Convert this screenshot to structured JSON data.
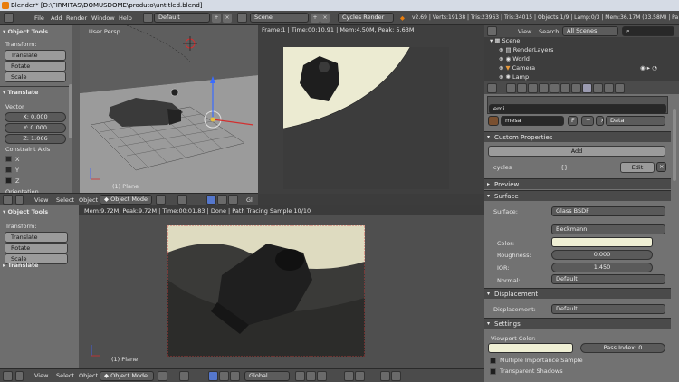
{
  "title": "Blender* [D:\\FIRMITAS\\DOMUSDOME\\produto\\untitled.blend]",
  "menu": {
    "items": [
      "File",
      "Add",
      "Render",
      "Window",
      "Help"
    ],
    "layout": "Default",
    "scene": "Scene",
    "engine": "Cycles Render",
    "stats": "v2.69 | Verts:19138 | Tris:23963 | Tris:34015 | Objects:1/9 | Lamp:0/3 | Mem:36.17M (33.58M) | Pa"
  },
  "tools": {
    "header": "Object Tools",
    "transform_label": "Transform:",
    "buttons": [
      "Translate",
      "Rotate",
      "Scale"
    ]
  },
  "translate_panel": {
    "header": "Translate",
    "vector_label": "Vector",
    "x": "X: 0.000",
    "y": "Y: 0.000",
    "z": "Z: 1.066",
    "constraint_label": "Constraint Axis",
    "axes": [
      "X",
      "Y",
      "Z"
    ],
    "orientation_label": "Orientation"
  },
  "tools2": {
    "header": "Object Tools",
    "transform_label": "Transform:",
    "buttons": [
      "Translate",
      "Rotate",
      "Scale"
    ],
    "translate": "Translate"
  },
  "viewport_top": {
    "label": "User Persp",
    "object": "(1) Plane"
  },
  "render_top": {
    "info": "Frame:1 | Time:00:10.91 | Mem:4.50M, Peak: 5.63M"
  },
  "header_mid": {
    "view": "View",
    "select": "Select",
    "object": "Object",
    "mode": "Object Mode",
    "gl": "Gl"
  },
  "render_bottom": {
    "info": "Mem:9.72M, Peak:9.72M | Time:00:01.83 | Done | Path Tracing Sample 10/10",
    "object": "(1) Plane"
  },
  "header_bottom": {
    "view": "View",
    "select": "Select",
    "object": "Object",
    "mode": "Object Mode",
    "orientation": "Global"
  },
  "outliner": {
    "view": "View",
    "search": "Search",
    "filter": "All Scenes",
    "items": [
      "Scene",
      "RenderLayers",
      "World",
      "Camera",
      "Lamp"
    ]
  },
  "properties": {
    "material_search": "emi",
    "material_name": "mesa",
    "f_label": "F",
    "data": "Data",
    "custom_props": "Custom Properties",
    "add": "Add",
    "cycles": "cycles",
    "cycles_val": "{}",
    "edit": "Edit",
    "preview": "Preview",
    "surface": "Surface",
    "surface_label": "Surface:",
    "surface_val": "Glass BSDF",
    "distribution": "Beckmann",
    "color_label": "Color:",
    "roughness_label": "Roughness:",
    "roughness": "0.000",
    "ior_label": "IOR:",
    "ior": "1.450",
    "normal_label": "Normal:",
    "normal": "Default",
    "displacement": "Displacement",
    "displacement_label": "Displacement:",
    "displacement_val": "Default",
    "settings": "Settings",
    "viewport_color": "Viewport Color:",
    "pass_index": "Pass Index: 0",
    "mis": "Multiple Importance Sample",
    "transparent": "Transparent Shadows",
    "colors": {
      "surface_color": "#efefd4",
      "viewport_color": "#efefd4"
    }
  }
}
